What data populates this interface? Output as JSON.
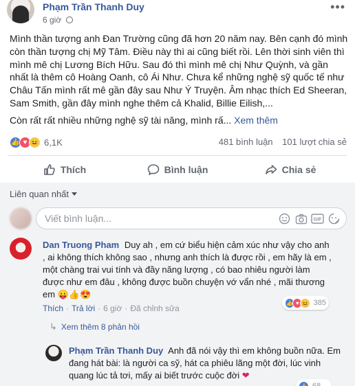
{
  "post": {
    "author": "Phạm Trần Thanh Duy",
    "time": "6 giờ",
    "paragraph1": "Mình thần tượng anh Đan Trường cũng đã hơn 20 năm nay. Bên cạnh đó mình còn thần tượng chị Mỹ Tâm. Điều này thì ai cũng biết rồi. Lên thời sinh viên thì mình mê chị Lương Bích Hữu. Sau đó thì mình mê chị Như Quỳnh, và gần nhất là thêm cô Hoàng Oanh, cô Ái Như. Chưa kể những nghệ sỹ quốc tế như Châu Tấn mình rất mê gần đây sau Như Ý Truyện. Âm nhạc thích Ed Sheeran, Sam Smith, gần đây mình nghe thêm cả Khalid, Billie Eilish,...",
    "paragraph2": "Còn rất rất nhiều những nghệ sỹ tài năng, mình rấ...",
    "see_more": "Xem thêm",
    "reaction_count": "6,1K",
    "comments_count": "481 bình luận",
    "shares_count": "101 lượt chia sẻ"
  },
  "actions": {
    "like": "Thích",
    "comment": "Bình luận",
    "share": "Chia sẻ"
  },
  "comments_section": {
    "sort_label": "Liên quan nhất",
    "input_placeholder": "Viết bình luận...",
    "input_icons": [
      "emoji-icon",
      "camera-icon",
      "gif-icon",
      "sticker-icon"
    ]
  },
  "comment1": {
    "author": "Dan Truong Pham",
    "text": "Duy ah , em cứ biểu hiện cảm xúc như vậy cho anh , ai không thích không sao , nhưng anh thích là được rồi , em hãy là em , một chàng trai vui tính và đầy năng lượng , có bao nhiêu người làm được như em đâu , không được buồn chuyện vớ vẩn nhé , mãi thương em",
    "emoji": "😛👍😍",
    "reaction_count": "385",
    "like": "Thích",
    "reply": "Trả lời",
    "time": "6 giờ",
    "edited": "Đã chỉnh sửa",
    "view_replies": "Xem thêm 8 phản hồi"
  },
  "comment2": {
    "author": "Phạm Trần Thanh Duy",
    "text": "Anh đã nói vậy thì em không buồn nữa. Em đang hát bài: là người ca sỹ, hát ca phiêu lãng một đời, lúc vinh quang lúc tả tơi, mấy ai biết trước cuộc đời",
    "heart": "❤",
    "reaction_count": "68"
  },
  "colors": {
    "link_blue": "#385898",
    "secondary_text": "#606770",
    "comment_bg": "#f2f3f5",
    "like_blue": "#4a7fd6",
    "love_red": "#f25268",
    "haha_yellow": "#f7c74c"
  }
}
